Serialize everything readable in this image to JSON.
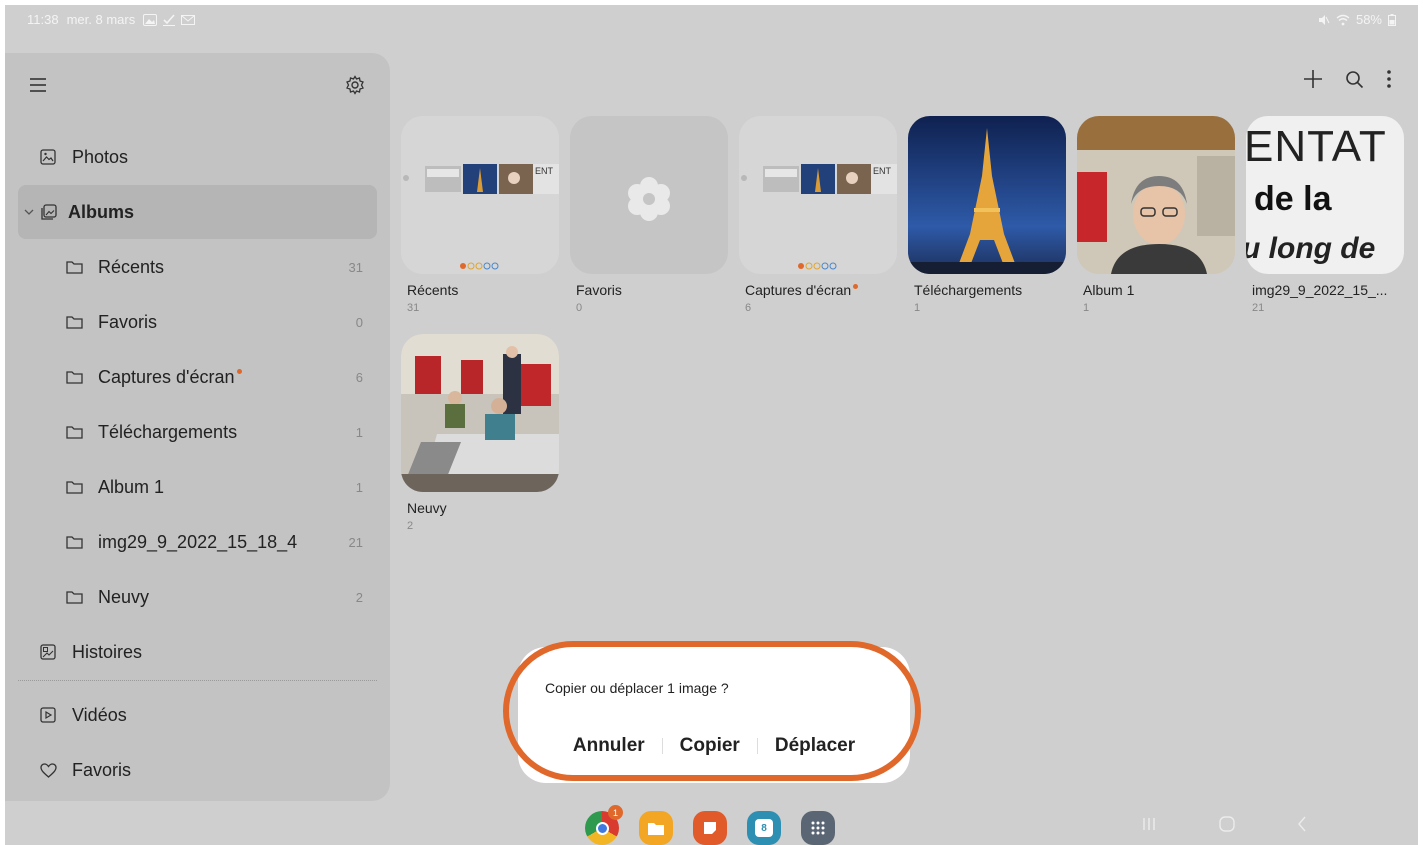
{
  "status_bar": {
    "time": "11:38",
    "date": "mer. 8 mars",
    "battery": "58%"
  },
  "sidebar": {
    "items": [
      {
        "label": "Photos",
        "icon": "photo-icon"
      },
      {
        "label": "Albums",
        "icon": "albums-icon",
        "selected": true
      },
      {
        "label": "Récents",
        "count": "31",
        "icon": "folder-icon"
      },
      {
        "label": "Favoris",
        "count": "0",
        "icon": "folder-icon"
      },
      {
        "label": "Captures d'écran",
        "count": "6",
        "icon": "folder-icon",
        "new_dot": true
      },
      {
        "label": "Téléchargements",
        "count": "1",
        "icon": "folder-icon"
      },
      {
        "label": "Album 1",
        "count": "1",
        "icon": "folder-icon"
      },
      {
        "label": "img29_9_2022_15_18_4",
        "count": "21",
        "icon": "folder-icon"
      },
      {
        "label": "Neuvy",
        "count": "2",
        "icon": "folder-icon"
      },
      {
        "label": "Histoires",
        "icon": "stories-icon"
      },
      {
        "label": "Vidéos",
        "icon": "video-icon"
      },
      {
        "label": "Favoris",
        "icon": "heart-icon"
      }
    ]
  },
  "albums": [
    {
      "name": "Récents",
      "count": "31",
      "thumb": "screenshot"
    },
    {
      "name": "Favoris",
      "count": "0",
      "thumb": "empty-flower"
    },
    {
      "name": "Captures d'écran",
      "count": "6",
      "thumb": "screenshot"
    },
    {
      "name": "Téléchargements",
      "count": "1",
      "thumb": "eiffel-night"
    },
    {
      "name": "Album 1",
      "count": "1",
      "thumb": "portrait"
    },
    {
      "name": "img29_9_2022_15_...",
      "count": "21",
      "thumb": "text-poster"
    },
    {
      "name": "Neuvy",
      "count": "2",
      "thumb": "classroom"
    }
  ],
  "poster_text": [
    "ENTAT",
    "de la",
    "u long de"
  ],
  "dialog": {
    "title": "Copier ou déplacer 1 image ?",
    "cancel": "Annuler",
    "copy": "Copier",
    "move": "Déplacer"
  },
  "dock": {
    "chrome_badge": "1",
    "calendar_day": "8"
  },
  "colors": {
    "accent": "#e0682a",
    "background": "#cfcfcf",
    "sidebar": "#c3c3c3"
  }
}
